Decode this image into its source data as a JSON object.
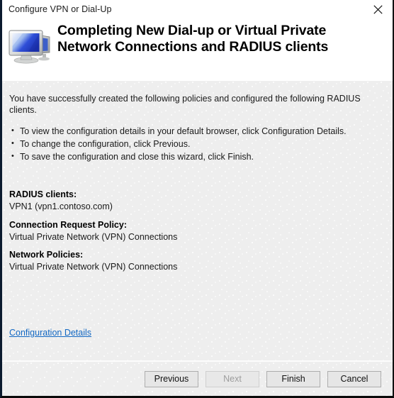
{
  "window": {
    "title": "Configure VPN or Dial-Up",
    "close_icon": "close-icon"
  },
  "header": {
    "icon": "computer-monitor-icon",
    "title": "Completing New Dial-up or Virtual Private Network Connections and RADIUS clients"
  },
  "body": {
    "intro": "You have successfully created the following policies and configured the following RADIUS clients.",
    "bullet_char": "•",
    "bullets": [
      "To view the configuration details in your default browser, click Configuration Details.",
      "To change the configuration, click Previous.",
      "To save the configuration and close this wizard, click Finish."
    ],
    "sections": [
      {
        "label": "RADIUS clients:",
        "value": "VPN1 (vpn1.contoso.com)"
      },
      {
        "label": "Connection Request Policy:",
        "value": "Virtual Private Network (VPN) Connections"
      },
      {
        "label": "Network Policies:",
        "value": "Virtual Private Network (VPN) Connections"
      }
    ],
    "config_link": "Configuration Details"
  },
  "footer": {
    "buttons": [
      {
        "label": "Previous",
        "disabled": false
      },
      {
        "label": "Next",
        "disabled": true
      },
      {
        "label": "Finish",
        "disabled": false
      },
      {
        "label": "Cancel",
        "disabled": false
      }
    ]
  },
  "colors": {
    "link": "#1268c3",
    "body_bg": "#eeeeee",
    "header_bg": "#ffffff",
    "border": "#0b1a2e",
    "disabled_text": "#9d9d9d"
  }
}
